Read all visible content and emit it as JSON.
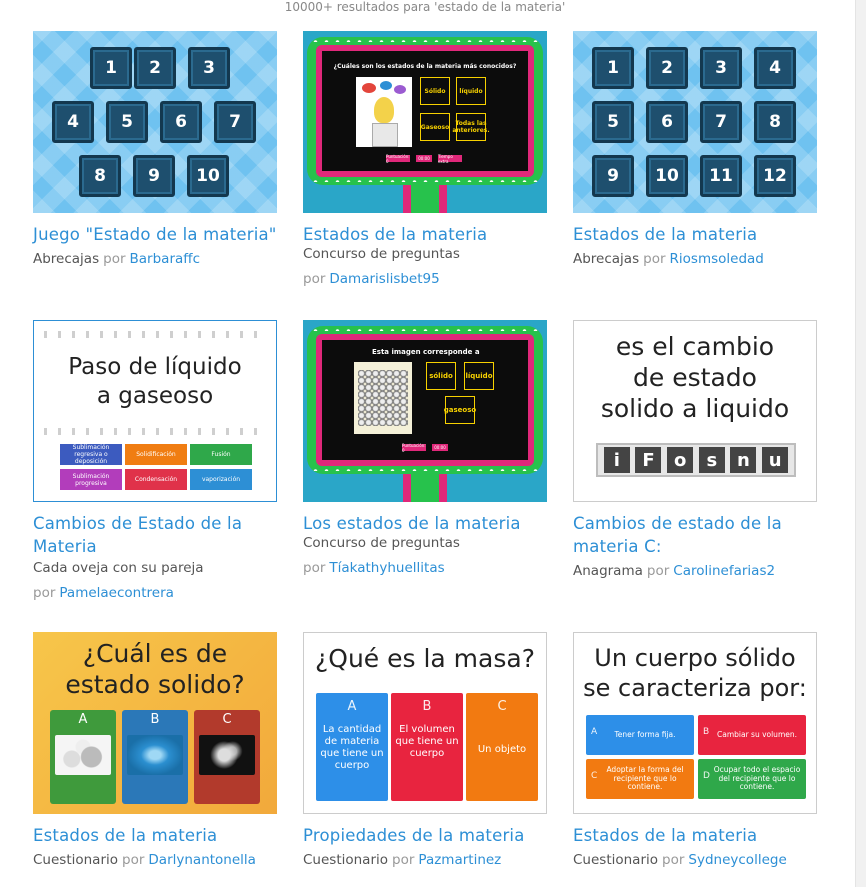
{
  "header": {
    "results": "10000+ resultados para 'estado de la materia'"
  },
  "por": "por",
  "cards": [
    {
      "title": "Juego \"Estado de la materia\"",
      "type": "Abrecajas",
      "author": "Barbaraffc",
      "thumb": {
        "kind": "boxes",
        "numbers": [
          "1",
          "2",
          "3",
          "4",
          "5",
          "6",
          "7",
          "8",
          "9",
          "10"
        ]
      }
    },
    {
      "title": "Estados de la materia",
      "type": "Concurso de preguntas",
      "author": "Damarislisbet95",
      "thumb": {
        "kind": "quizshow",
        "question": "¿Cuáles son los estados de la materia más conocidos?",
        "options": [
          "Sólido",
          "líquido",
          "Gaseoso",
          "Todas las anteriores."
        ],
        "letters": [
          "A",
          "B",
          "C",
          "D"
        ],
        "pills": [
          "Puntuación: 0",
          "00:00",
          "Tiempo extra"
        ]
      }
    },
    {
      "title": "Estados de la materia",
      "type": "Abrecajas",
      "author": "Riosmsoledad",
      "thumb": {
        "kind": "boxes",
        "numbers": [
          "1",
          "2",
          "3",
          "4",
          "5",
          "6",
          "7",
          "8",
          "9",
          "10",
          "11",
          "12"
        ]
      }
    },
    {
      "title": "Cambios de Estado de la Materia",
      "type": "Cada oveja con su pareja",
      "author": "Pamelaecontrera",
      "thumb": {
        "kind": "matching",
        "heading": [
          "Paso de líquido",
          "a gaseoso"
        ],
        "tiles": [
          {
            "text": "Sublimación regresiva o deposición",
            "color": "#3c5bbf"
          },
          {
            "text": "Solidificación",
            "color": "#f07d12"
          },
          {
            "text": "Fusión",
            "color": "#2fa84a"
          },
          {
            "text": "Sublimación progresiva",
            "color": "#b23dbb"
          },
          {
            "text": "Condensación",
            "color": "#e0324a"
          },
          {
            "text": "vaporización",
            "color": "#2d8fd5"
          }
        ]
      }
    },
    {
      "title": "Los estados de la materia",
      "type": "Concurso de preguntas",
      "author": "Tíakathyhuellitas",
      "thumb": {
        "kind": "quizshow2",
        "question": "Esta imagen corresponde a",
        "options": [
          "sólido",
          "líquido",
          "gaseoso"
        ],
        "letters": [
          "A",
          "B",
          "C"
        ],
        "pills": [
          "Puntuación: 0",
          "00:00"
        ]
      }
    },
    {
      "title": "Cambios de estado de la materia C:",
      "type": "Anagrama",
      "author": "Carolinefarias2",
      "thumb": {
        "kind": "anagram",
        "lines": [
          "es el cambio",
          "de estado",
          "solido a liquido"
        ],
        "letters": [
          "i",
          "F",
          "o",
          "s",
          "n",
          "u"
        ]
      }
    },
    {
      "title": "Estados de la materia",
      "type": "Cuestionario",
      "author": "Darlynantonella",
      "thumb": {
        "kind": "quiz-orange",
        "lines": [
          "¿Cuál es de",
          "estado solido?"
        ],
        "letters": [
          "A",
          "B",
          "C"
        ],
        "colors": [
          "#3f9a3c",
          "#2b78b8",
          "#b23a2c"
        ]
      }
    },
    {
      "title": "Propiedades de la materia",
      "type": "Cuestionario",
      "author": "Pazmartinez",
      "thumb": {
        "kind": "quiz-white",
        "heading": "¿Qué es la masa?",
        "letters": [
          "A",
          "B",
          "C"
        ],
        "answers": [
          "La cantidad de materia que tiene un cuerpo",
          "El volumen que tiene un cuerpo",
          "Un objeto"
        ],
        "colors": [
          "#2d8fe8",
          "#e8243f",
          "#f27a11"
        ]
      }
    },
    {
      "title": "Estados de la materia",
      "type": "Cuestionario",
      "author": "Sydneycollege",
      "thumb": {
        "kind": "quiz-white2",
        "lines": [
          "Un cuerpo sólido",
          "se caracteriza por:"
        ],
        "letters": [
          "A",
          "B",
          "C",
          "D"
        ],
        "answers": [
          "Tener forma fija.",
          "Cambiar su volumen.",
          "Adoptar la forma del recipiente que lo contiene.",
          "Ocupar todo el espacio del recipiente que lo contiene."
        ],
        "colors": [
          "#2d8fe8",
          "#e8243f",
          "#f27a11",
          "#2fa84a"
        ]
      }
    }
  ]
}
